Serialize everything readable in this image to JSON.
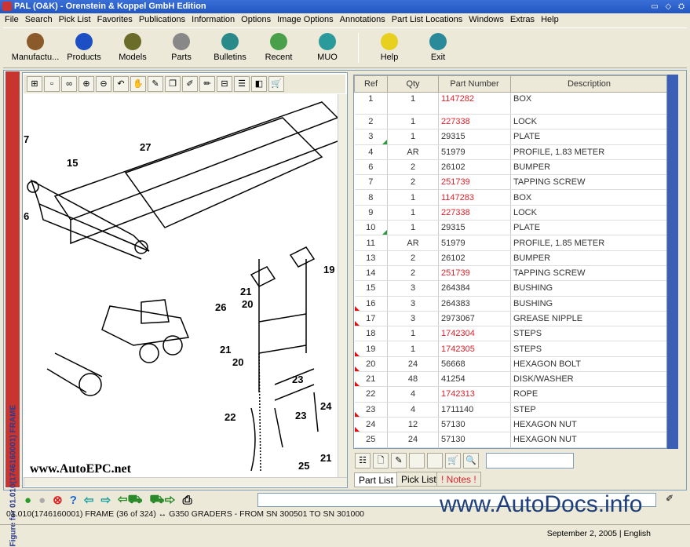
{
  "window": {
    "title": "PAL (O&K) - Orenstein & Koppel GmbH Edition",
    "controls": "▭ ◇ ⛭"
  },
  "menu": [
    "File",
    "Search",
    "Pick List",
    "Favorites",
    "Publications",
    "Information",
    "Options",
    "Image Options",
    "Annotations",
    "Part List Locations",
    "Windows",
    "Extras",
    "Help"
  ],
  "toolbar": [
    {
      "label": "Manufactu...",
      "icon": "factory-icon",
      "color": "#8a5a2a"
    },
    {
      "label": "Products",
      "icon": "globe-icon",
      "color": "#1c4fc4"
    },
    {
      "label": "Models",
      "icon": "loader-icon",
      "color": "#6b6b2a"
    },
    {
      "label": "Parts",
      "icon": "bolt-icon",
      "color": "#888"
    },
    {
      "label": "Bulletins",
      "icon": "bulletin-icon",
      "color": "#2a8a8a"
    },
    {
      "label": "Recent",
      "icon": "recent-icon",
      "color": "#4aa04a"
    },
    {
      "label": "MUO",
      "icon": "muo-icon",
      "color": "#2a9a9a"
    }
  ],
  "toolbar2": [
    {
      "label": "Help",
      "icon": "help-icon",
      "color": "#e8d020"
    },
    {
      "label": "Exit",
      "icon": "exit-icon",
      "color": "#2a8a9a"
    }
  ],
  "figure_caption": "Figure for 01.010(1746160001) FRAME",
  "drawing": {
    "watermark": "www.AutoEPC.net",
    "callouts": [
      "7",
      "15",
      "27",
      "6",
      "19",
      "21",
      "20",
      "26",
      "21",
      "20",
      "23",
      "22",
      "23",
      "24",
      "21",
      "25"
    ]
  },
  "parts": {
    "columns": [
      "Ref",
      "Qty",
      "Part Number",
      "Description"
    ],
    "rows": [
      {
        "ref": "1",
        "qty": "1",
        "pn": "1147282",
        "desc": "BOX",
        "red": true
      },
      {
        "ref": "2",
        "qty": "1",
        "pn": "227338",
        "desc": "LOCK",
        "red": true
      },
      {
        "ref": "3",
        "qty": "1",
        "pn": "29315",
        "desc": "PLATE",
        "green": true
      },
      {
        "ref": "4",
        "qty": "AR",
        "pn": "51979",
        "desc": "PROFILE, 1.83 METER"
      },
      {
        "ref": "6",
        "qty": "2",
        "pn": "26102",
        "desc": "BUMPER"
      },
      {
        "ref": "7",
        "qty": "2",
        "pn": "251739",
        "desc": "TAPPING SCREW",
        "red": true
      },
      {
        "ref": "8",
        "qty": "1",
        "pn": "1147283",
        "desc": "BOX",
        "red": true
      },
      {
        "ref": "9",
        "qty": "1",
        "pn": "227338",
        "desc": "LOCK",
        "red": true
      },
      {
        "ref": "10",
        "qty": "1",
        "pn": "29315",
        "desc": "PLATE",
        "green": true
      },
      {
        "ref": "11",
        "qty": "AR",
        "pn": "51979",
        "desc": "PROFILE, 1.85 METER"
      },
      {
        "ref": "13",
        "qty": "2",
        "pn": "26102",
        "desc": "BUMPER"
      },
      {
        "ref": "14",
        "qty": "2",
        "pn": "251739",
        "desc": "TAPPING SCREW",
        "red": true
      },
      {
        "ref": "15",
        "qty": "3",
        "pn": "264384",
        "desc": "BUSHING"
      },
      {
        "ref": "16",
        "qty": "3",
        "pn": "264383",
        "desc": "BUSHING",
        "flag": true
      },
      {
        "ref": "17",
        "qty": "3",
        "pn": "2973067",
        "desc": "GREASE NIPPLE",
        "flag": true
      },
      {
        "ref": "18",
        "qty": "1",
        "pn": "1742304",
        "desc": "STEPS",
        "red": true
      },
      {
        "ref": "19",
        "qty": "1",
        "pn": "1742305",
        "desc": "STEPS",
        "red": true,
        "flag": true
      },
      {
        "ref": "20",
        "qty": "24",
        "pn": "56668",
        "desc": "HEXAGON BOLT",
        "flag": true
      },
      {
        "ref": "21",
        "qty": "48",
        "pn": "41254",
        "desc": "DISK/WASHER",
        "flag": true
      },
      {
        "ref": "22",
        "qty": "4",
        "pn": "1742313",
        "desc": "ROPE",
        "red": true
      },
      {
        "ref": "23",
        "qty": "4",
        "pn": "1711140",
        "desc": "STEP",
        "flag": true
      },
      {
        "ref": "24",
        "qty": "12",
        "pn": "57130",
        "desc": "HEXAGON NUT",
        "flag": true
      },
      {
        "ref": "25",
        "qty": "24",
        "pn": "57130",
        "desc": "HEXAGON NUT"
      }
    ],
    "search_value": ""
  },
  "tabs": [
    "Part List",
    "Pick List",
    "! Notes !"
  ],
  "status_line": "01.010(1746160001) FRAME (36 of 324) ↔ G350 GRADERS - FROM SN 300501 TO SN 301000",
  "watermark": "www.AutoDocs.info",
  "statusbar": "September 2, 2005 | English"
}
